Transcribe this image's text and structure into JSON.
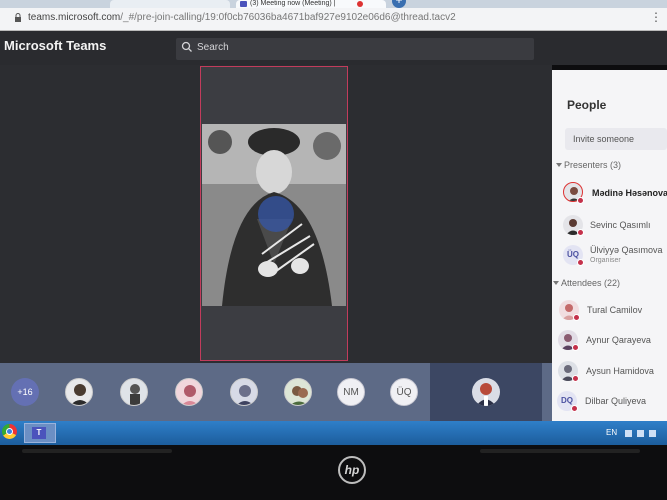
{
  "browser": {
    "tabs": [
      {
        "label": ""
      },
      {
        "label": "(3) Meeting now (Meeting) |"
      }
    ],
    "new_tab": "+",
    "url_host": "teams.microsoft.com",
    "url_path": "/_#/pre-join-calling/19:0f0cb76036ba4671baf927e9102e06d6@thread.tacv2",
    "menu": "⋮"
  },
  "app": {
    "title": "Microsoft Teams",
    "search_placeholder": "Search"
  },
  "bar": {
    "more_count": "+16",
    "initial_avatars": [
      "NM",
      "ÜQ"
    ]
  },
  "people": {
    "title": "People",
    "invite_placeholder": "Invite someone",
    "presenters_label": "Presenters (3)",
    "attendees_label": "Attendees (22)",
    "presenters": [
      {
        "name": "Mədinə Həsənova",
        "initials": "",
        "sub": ""
      },
      {
        "name": "Sevinc Qasımlı",
        "initials": "",
        "sub": ""
      },
      {
        "name": "Ülviyyə Qasımova",
        "initials": "ÜQ",
        "sub": "Organiser"
      }
    ],
    "attendees": [
      {
        "name": "Tural Camilov",
        "initials": ""
      },
      {
        "name": "Aynur Qarayeva",
        "initials": ""
      },
      {
        "name": "Aysun Hamidova",
        "initials": ""
      },
      {
        "name": "Dilbar Quliyeva",
        "initials": "DQ"
      }
    ]
  },
  "taskbar": {
    "teams_glyph": "T",
    "language": "EN"
  },
  "laptop": {
    "brand": "hp"
  },
  "colors": {
    "accent": "#6470b3",
    "presence_busy": "#c4314b",
    "active_border": "#c23c5c"
  }
}
